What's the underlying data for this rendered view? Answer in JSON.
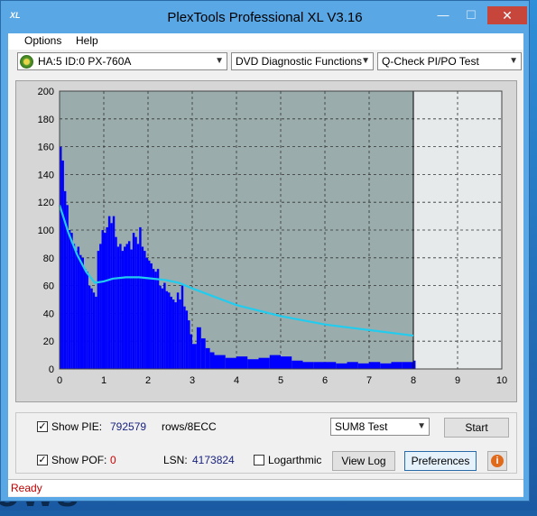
{
  "window": {
    "title": "PlexTools Professional XL V3.16",
    "icon_label": "XL",
    "controls": {
      "minimize": "—",
      "maximize": "☐",
      "close": "✕"
    }
  },
  "menu": {
    "options": "Options",
    "help": "Help"
  },
  "toolbar": {
    "drive": "HA:5 ID:0  PX-760A",
    "function": "DVD Diagnostic Functions",
    "test": "Q-Check PI/PO Test"
  },
  "chart_data": {
    "type": "area",
    "x_ticks": [
      "0",
      "1",
      "2",
      "3",
      "4",
      "5",
      "6",
      "7",
      "8",
      "9",
      "10"
    ],
    "y_ticks": [
      "0",
      "20",
      "40",
      "60",
      "80",
      "100",
      "120",
      "140",
      "160",
      "180",
      "200"
    ],
    "xlim": [
      0,
      10
    ],
    "ylim": [
      0,
      200
    ],
    "grid": true,
    "scan_end_x": 8,
    "colors": {
      "bars": "#0000ff",
      "curve": "#22ccee",
      "background_scanned": "#9aacab",
      "background_unscanned": "#e6eaea"
    },
    "series": [
      {
        "kind": "bars",
        "x": [
          0.0,
          0.05,
          0.1,
          0.15,
          0.2,
          0.25,
          0.3,
          0.35,
          0.4,
          0.45,
          0.5,
          0.55,
          0.6,
          0.65,
          0.7,
          0.75,
          0.8,
          0.85,
          0.9,
          0.95,
          1.0,
          1.05,
          1.1,
          1.15,
          1.2,
          1.25,
          1.3,
          1.35,
          1.4,
          1.45,
          1.5,
          1.55,
          1.6,
          1.65,
          1.7,
          1.75,
          1.8,
          1.85,
          1.9,
          1.95,
          2.0,
          2.05,
          2.1,
          2.15,
          2.2,
          2.25,
          2.3,
          2.35,
          2.4,
          2.45,
          2.5,
          2.55,
          2.6,
          2.65,
          2.7,
          2.75,
          2.8,
          2.85,
          2.9,
          2.95,
          3.0,
          3.1,
          3.2,
          3.3,
          3.4,
          3.5,
          3.75,
          4.0,
          4.25,
          4.5,
          4.75,
          5.0,
          5.25,
          5.5,
          5.75,
          6.0,
          6.25,
          6.5,
          6.75,
          7.0,
          7.25,
          7.5,
          7.75,
          8.0
        ],
        "values": [
          160,
          150,
          128,
          118,
          100,
          98,
          90,
          85,
          88,
          82,
          80,
          72,
          70,
          60,
          58,
          55,
          52,
          85,
          90,
          100,
          98,
          102,
          110,
          105,
          110,
          95,
          88,
          90,
          85,
          88,
          90,
          92,
          86,
          98,
          95,
          90,
          102,
          88,
          85,
          80,
          78,
          76,
          72,
          70,
          72,
          60,
          58,
          62,
          56,
          55,
          52,
          50,
          48,
          55,
          50,
          60,
          45,
          42,
          35,
          25,
          18,
          30,
          22,
          15,
          12,
          10,
          8,
          9,
          7,
          8,
          10,
          9,
          6,
          5,
          5,
          5,
          4,
          5,
          4,
          5,
          4,
          5,
          5,
          6
        ]
      },
      {
        "kind": "line",
        "x": [
          0,
          0.1,
          0.2,
          0.4,
          0.6,
          0.8,
          1.0,
          1.2,
          1.5,
          1.8,
          2.1,
          2.4,
          2.7,
          3.0,
          3.5,
          4.0,
          4.5,
          5.0,
          5.5,
          6.0,
          6.5,
          7.0,
          7.5,
          8.0
        ],
        "values": [
          118,
          108,
          98,
          82,
          70,
          62,
          63,
          65,
          66,
          66,
          65,
          64,
          62,
          58,
          52,
          46,
          42,
          38,
          35,
          32,
          30,
          28,
          26,
          24
        ]
      }
    ]
  },
  "panel": {
    "show_pie": "Show PIE:",
    "pie_value": "792579",
    "pie_unit": "rows/8ECC",
    "show_poe": "Show POF:",
    "poe_value": "0",
    "lsn_label": "LSN:",
    "lsn_value": "4173824",
    "logarithmic": "Logarthmic",
    "sum_test": "SUM8 Test",
    "start": "Start",
    "view_log": "View Log",
    "preferences": "Preferences",
    "check": "✓",
    "info": "i"
  },
  "status": {
    "text": "Ready"
  },
  "desktop": {
    "text": "ows"
  }
}
